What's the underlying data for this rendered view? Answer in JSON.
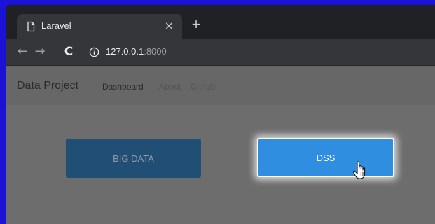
{
  "browser": {
    "tab_title": "Laravel",
    "tab_close": "×",
    "new_tab": "+",
    "back": "←",
    "forward": "→",
    "reload": "C",
    "url_host": "127.0.0.1",
    "url_port": ":8000"
  },
  "navbar": {
    "brand": "Data Project",
    "links": [
      "Dashboard",
      "About",
      "Github"
    ]
  },
  "buttons": {
    "big_data": "BIG DATA",
    "dss": "DSS"
  },
  "icons": {
    "tab": "document-icon",
    "security": "info-icon",
    "cursor": "hand-pointer-icon"
  },
  "colors": {
    "frame_border": "#1a13d6",
    "big_data_button": "#214e75",
    "dss_button": "#2f8ee0"
  }
}
